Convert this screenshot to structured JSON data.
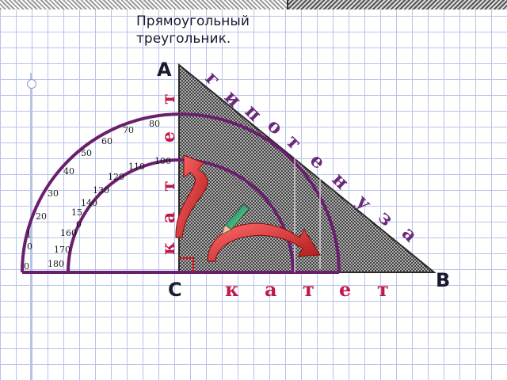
{
  "title": "Прямоугольный\nтреугольник.",
  "vertices": {
    "A": "A",
    "B": "B",
    "C": "C"
  },
  "labels": {
    "hypotenuse_letters": [
      "г",
      "и",
      "п",
      "о",
      "т",
      "е",
      "н",
      "у",
      "з",
      "а"
    ],
    "vertical_leg_letters": [
      "к",
      "а",
      "т",
      "е",
      "т"
    ],
    "horizontal_leg_letters": [
      "к",
      "а",
      "т",
      "е",
      "т"
    ]
  },
  "protractor": {
    "outer_scale": [
      "0",
      "10",
      "20",
      "30",
      "40",
      "50",
      "60",
      "70",
      "80"
    ],
    "inner_scale": [
      "180",
      "170",
      "160",
      "150",
      "140",
      "130",
      "120",
      "110",
      "100"
    ]
  },
  "colors": {
    "triangle_outline": "#2a2a2a",
    "leg_labels": "#c0184a",
    "hypotenuse_label": "#6a2a7a",
    "protractor": "#6a1f6e",
    "arrow": "#d62a2a"
  }
}
